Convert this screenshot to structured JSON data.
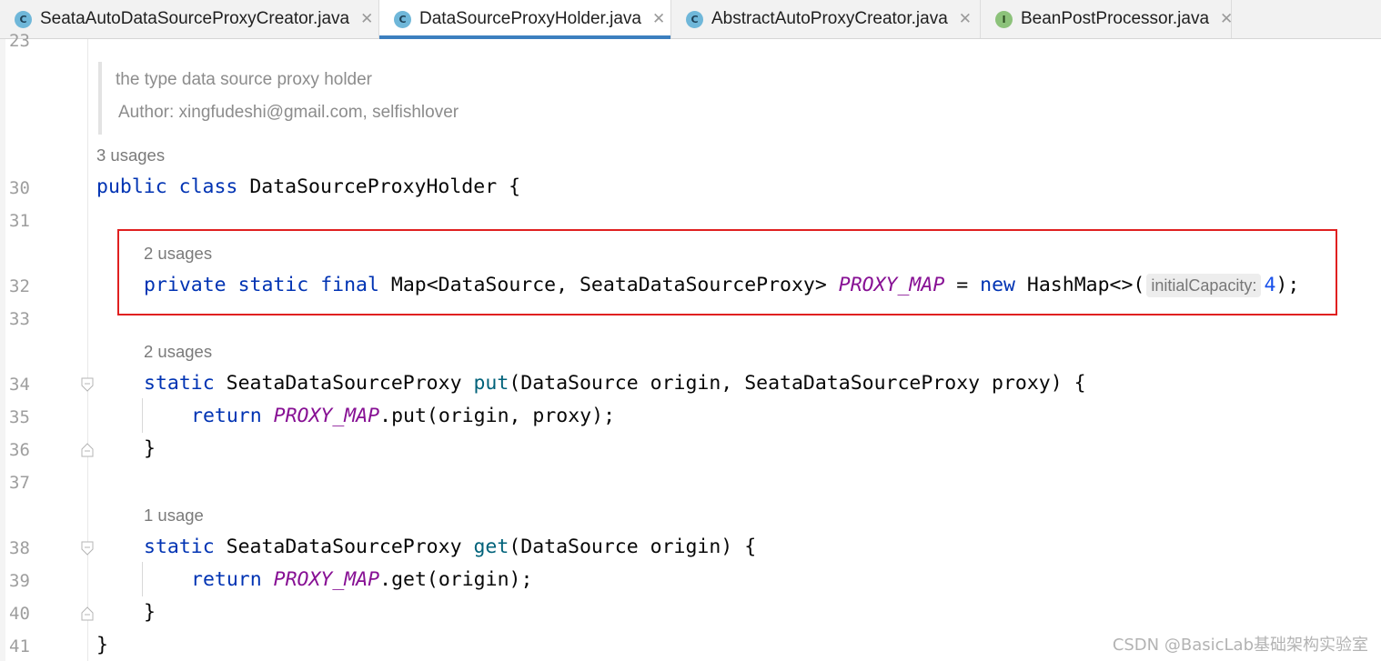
{
  "tabs": [
    {
      "label": "SeataAutoDataSourceProxyCreator.java",
      "icon": "class-icon",
      "active": false
    },
    {
      "label": "DataSourceProxyHolder.java",
      "icon": "class-icon",
      "active": true
    },
    {
      "label": "AbstractAutoProxyCreator.java",
      "icon": "class-icon",
      "active": false
    },
    {
      "label": "BeanPostProcessor.java",
      "icon": "interface-icon",
      "active": false
    }
  ],
  "icon_letters": {
    "class": "C",
    "interface": "I"
  },
  "close_glyph": "✕",
  "line_numbers": [
    "23",
    "30",
    "31",
    "32",
    "33",
    "34",
    "35",
    "36",
    "37",
    "38",
    "39",
    "40",
    "41"
  ],
  "javadoc": {
    "description": "the type data source proxy holder",
    "author": "Author: xingfudeshi@gmail.com, selfishlover"
  },
  "usages": {
    "class": "3 usages",
    "field": "2 usages",
    "put": "2 usages",
    "get": "1 usage"
  },
  "code": {
    "kw_public": "public",
    "kw_class": "class",
    "class_name": "DataSourceProxyHolder",
    "open_brace": "{",
    "close_brace": "}",
    "kw_private": "private",
    "kw_static": "static",
    "kw_final": "final",
    "field_type": "Map<DataSource, SeataDataSourceProxy>",
    "field_name": "PROXY_MAP",
    "assign": "=",
    "kw_new": "new",
    "ctor": "HashMap<>(",
    "hint_label": "initialCapacity:",
    "hint_value": "4",
    "ctor_end": ");",
    "ret_type": "SeataDataSourceProxy",
    "put_name": "put",
    "put_params": "(DataSource origin, SeataDataSourceProxy proxy) {",
    "kw_return": "return",
    "put_call": ".put(origin, proxy);",
    "get_name": "get",
    "get_params": "(DataSource origin) {",
    "get_call": ".get(origin);"
  },
  "watermark": "CSDN @BasicLab基础架构实验室",
  "colors": {
    "keyword": "#0033b3",
    "method": "#00627a",
    "constant_field": "#871094",
    "number": "#1750eb",
    "active_tab_underline": "#3c7fbf",
    "highlight_box": "#e02020"
  }
}
